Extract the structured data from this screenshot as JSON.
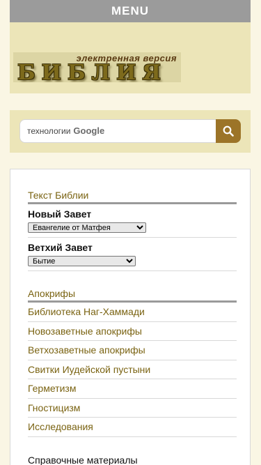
{
  "menu": {
    "label": "MENU"
  },
  "logo": {
    "subtitle": "электренная версия",
    "title": "БИБЛИЯ"
  },
  "search": {
    "placeholder": "технологии",
    "brand": "Google"
  },
  "bible_text": {
    "heading": "Текст Библии",
    "new_testament": {
      "label": "Новый Завет",
      "selected": "Евангелие от Матфея"
    },
    "old_testament": {
      "label": "Ветхий Завет",
      "selected": "Бытие"
    }
  },
  "apocrypha": {
    "heading": "Апокрифы",
    "items": [
      "Библиотека Наг-Хаммади",
      "Новозаветные апокрифы",
      "Ветхозаветные апокрифы",
      "Свитки Иудейской пустыни",
      "Герметизм",
      "Гностицизм",
      "Исследования"
    ]
  },
  "reference": {
    "heading": "Справочные материалы"
  },
  "colors": {
    "accent": "#7a6312",
    "menu_bg": "#9b9b9b",
    "panel_bg": "#ece5b8",
    "search_button": "#9c7428"
  }
}
